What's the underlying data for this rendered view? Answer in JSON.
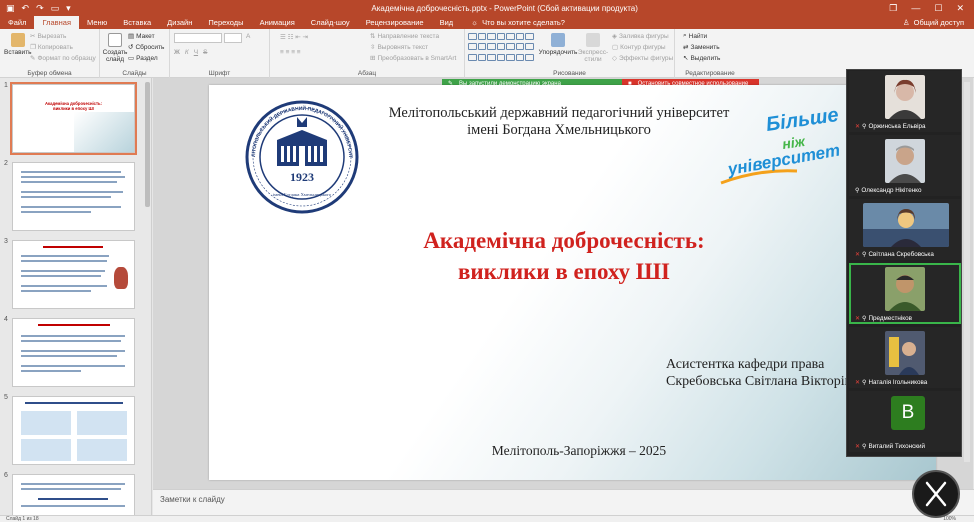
{
  "titlebar": {
    "title": "Академічна доброчесність.pptx - PowerPoint (Сбой активации продукта)",
    "qat_icons": [
      "save-icon",
      "undo-icon",
      "redo-icon",
      "present-icon",
      "customize-icon"
    ],
    "controls": {
      "restore": "❐",
      "minimize": "—",
      "maximize": "☐",
      "close": "✕"
    }
  },
  "tabs": {
    "items": [
      "Файл",
      "Главная",
      "Меню",
      "Вставка",
      "Дизайн",
      "Переходы",
      "Анимация",
      "Слайд-шоу",
      "Рецензирование",
      "Вид"
    ],
    "active": 1,
    "tellme": "Что вы хотите сделать?",
    "share": "Общий доступ"
  },
  "ribbon": {
    "clipboard": {
      "paste": "Вставить",
      "cut": "Вырезать",
      "copy": "Копировать",
      "format_painter": "Формат по образцу",
      "label": "Буфер обмена"
    },
    "slides": {
      "new_slide": "Создать слайд",
      "layout": "Макет",
      "reset": "Сбросить",
      "section": "Раздел",
      "label": "Слайды"
    },
    "font": {
      "label": "Шрифт",
      "bold": "Ж",
      "italic": "К",
      "underline": "Ч",
      "strike": "S",
      "aa": "A"
    },
    "paragraph": {
      "text_direction": "Направление текста",
      "align_text": "Выровнять текст",
      "smartart": "Преобразовать в SmartArt",
      "label": "Абзац"
    },
    "drawing": {
      "arrange": "Упорядочить",
      "quick_styles": "Экспресс-стили",
      "shape_fill": "Заливка фигуры",
      "shape_outline": "Контур фигуры",
      "shape_effects": "Эффекты фигуры",
      "label": "Рисование"
    },
    "editing": {
      "find": "Найти",
      "replace": "Заменить",
      "select": "Выделить",
      "label": "Редактирование"
    }
  },
  "banner": {
    "sharing": "Вы запустили демонстрацию экрана",
    "stop": "Остановить совместное использование"
  },
  "thumbnails": {
    "numbers": [
      "1",
      "2",
      "3",
      "4",
      "5",
      "6"
    ],
    "selected": 0
  },
  "slide": {
    "university_line1": "Мелітопольський державний педагогічний університет",
    "university_line2": "імені Богдана Хмельницького",
    "title_line1": "Академічна доброчесність:",
    "title_line2": "виклики в епоху ШІ",
    "author_line1": "Асистентка кафедри права",
    "author_line2": "Скребовська Світлана Вікторівна",
    "city": "Мелітополь-Запоріжжя – 2025",
    "seal_year": "1923",
    "seal_text": "МЕЛІТОПОЛЬСЬКИЙ ДЕРЖАВНИЙ ПЕДАГОГІЧНИЙ УНІВЕРСИТЕТ",
    "seal_bottom": "імені Богдана Хмельницького",
    "brand_line1": "Більше",
    "brand_line2": "ніж",
    "brand_line3": "університет"
  },
  "notes": {
    "placeholder": "Заметки к слайду"
  },
  "statusbar": {
    "slide_count": "Слайд 1 из 18",
    "zoom": "100%"
  },
  "participants": [
    {
      "name": "Оржинська Ельвіра",
      "muted": true,
      "avatar": "photo",
      "colors": [
        "#d8b8a8",
        "#7a3d2d"
      ]
    },
    {
      "name": "Олександр Нікітенко",
      "muted": false,
      "avatar": "photo",
      "colors": [
        "#c9a48a",
        "#4a4a4a"
      ]
    },
    {
      "name": "Світлана Скребовська",
      "muted": true,
      "avatar": "photo",
      "colors": [
        "#f0c880",
        "#6a8aa8"
      ]
    },
    {
      "name": "Предместніков",
      "muted": true,
      "avatar": "photo",
      "active": true,
      "colors": [
        "#8aa06a",
        "#3a5a2a"
      ]
    },
    {
      "name": "Наталія Ігольникова",
      "muted": true,
      "avatar": "photo",
      "colors": [
        "#e8c040",
        "#505a70"
      ]
    },
    {
      "name": "Виталий Тихонский",
      "muted": true,
      "avatar": "letter",
      "letter": "В",
      "colors": [
        "#2d7d1f"
      ]
    }
  ]
}
